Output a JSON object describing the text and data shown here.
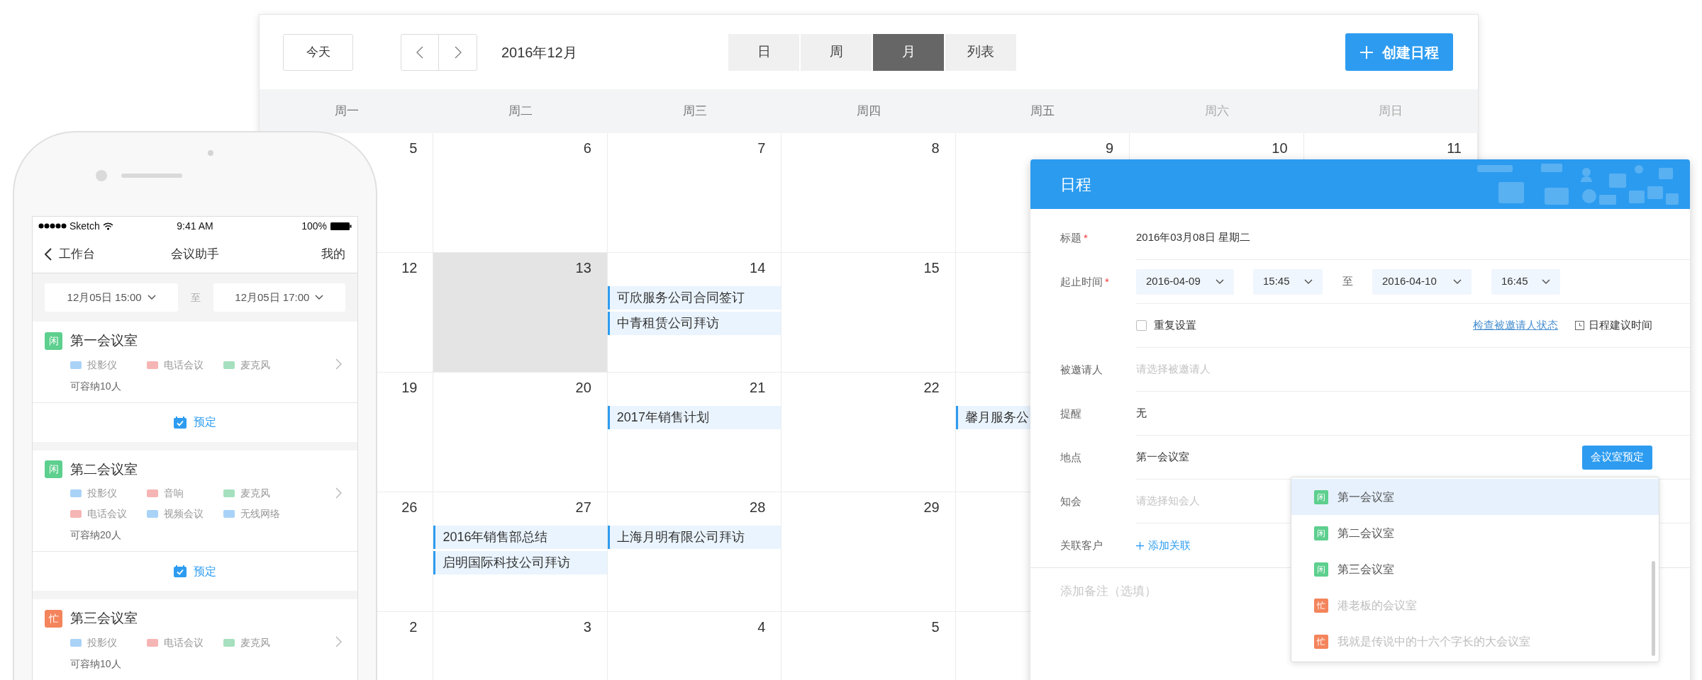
{
  "calendar": {
    "today_button": "今天",
    "month_title": "2016年12月",
    "views": [
      {
        "label": "日",
        "selected": false
      },
      {
        "label": "周",
        "selected": false
      },
      {
        "label": "月",
        "selected": true
      },
      {
        "label": "列表",
        "selected": false
      }
    ],
    "create_button": "创建日程",
    "weekdays": [
      {
        "label": "周一",
        "weekend": false
      },
      {
        "label": "周二",
        "weekend": false
      },
      {
        "label": "周三",
        "weekend": false
      },
      {
        "label": "周四",
        "weekend": false
      },
      {
        "label": "周五",
        "weekend": false
      },
      {
        "label": "周六",
        "weekend": true
      },
      {
        "label": "周日",
        "weekend": true
      }
    ],
    "weeks": [
      [
        {
          "day": "5",
          "shaded": false
        },
        {
          "day": "6",
          "shaded": false
        },
        {
          "day": "7",
          "shaded": false
        },
        {
          "day": "8",
          "shaded": false
        },
        {
          "day": "9",
          "shaded": false
        },
        {
          "day": "10",
          "shaded": false
        },
        {
          "day": "11",
          "shaded": false
        }
      ],
      [
        {
          "day": "12",
          "shaded": false
        },
        {
          "day": "13",
          "shaded": true
        },
        {
          "day": "14",
          "shaded": false,
          "events": [
            "可欣服务公司合同签订",
            "中青租赁公司拜访"
          ]
        },
        {
          "day": "15",
          "shaded": false
        },
        {
          "shaded": false
        }
      ],
      [
        {
          "day": "19",
          "shaded": false
        },
        {
          "day": "20",
          "shaded": false
        },
        {
          "day": "21",
          "shaded": false,
          "events": [
            "2017年销售计划"
          ]
        },
        {
          "day": "22",
          "shaded": false
        },
        {
          "shaded": false,
          "events": [
            "馨月服务公"
          ]
        }
      ],
      [
        {
          "day": "26",
          "shaded": false
        },
        {
          "day": "27",
          "shaded": false,
          "events": [
            "2016年销售部总结",
            "启明国际科技公司拜访"
          ]
        },
        {
          "day": "28",
          "shaded": false,
          "events": [
            "上海月明有限公司拜访"
          ]
        },
        {
          "day": "29",
          "shaded": false
        },
        {
          "shaded": false
        }
      ],
      [
        {
          "day": "2",
          "shaded": false
        },
        {
          "day": "3",
          "shaded": false
        },
        {
          "day": "4",
          "shaded": false
        },
        {
          "day": "5",
          "shaded": false
        },
        {
          "shaded": false
        }
      ]
    ]
  },
  "phone": {
    "status_bar": {
      "carrier": "Sketch",
      "time": "9:41 AM",
      "battery": "100%"
    },
    "nav": {
      "back": "工作台",
      "title": "会议助手",
      "right": "我的"
    },
    "filter": {
      "start": "12月05日 15:00",
      "separator": "至",
      "end": "12月05日 17:00"
    },
    "rooms": [
      {
        "kind": "free",
        "status": "闲",
        "name": "第一会议室",
        "facilities": [
          {
            "label": "投影仪",
            "color": "#a9d2f7"
          },
          {
            "label": "电话会议",
            "color": "#f5b5b5"
          },
          {
            "label": "麦克风",
            "color": "#a6e0bf"
          }
        ],
        "capacity": "可容纳10人",
        "book": "预定"
      },
      {
        "kind": "free",
        "status": "闲",
        "name": "第二会议室",
        "facilities": [
          {
            "label": "投影仪",
            "color": "#a9d2f7"
          },
          {
            "label": "音响",
            "color": "#f5b5b5"
          },
          {
            "label": "麦克风",
            "color": "#a6e0bf"
          },
          {
            "label": "电话会议",
            "color": "#f5b5b5"
          },
          {
            "label": "视频会议",
            "color": "#a9d2f7"
          },
          {
            "label": "无线网络",
            "color": "#a9d2f7"
          }
        ],
        "capacity": "可容纳20人",
        "book": "预定"
      },
      {
        "kind": "busy",
        "status": "忙",
        "name": "第三会议室",
        "facilities": [
          {
            "label": "投影仪",
            "color": "#a9d2f7"
          },
          {
            "label": "电话会议",
            "color": "#f5b5b5"
          },
          {
            "label": "麦克风",
            "color": "#a6e0bf"
          }
        ],
        "capacity": "可容纳10人"
      }
    ]
  },
  "dialog": {
    "title": "日程",
    "fields": [
      {
        "kind": "text",
        "label": "标题",
        "required_mark": "*",
        "value": "2016年03月08日 星期二"
      },
      {
        "kind": "time",
        "label": "起止时间",
        "required_mark": "*",
        "start_date": "2016-04-09",
        "start_time": "15:45",
        "separator": "至",
        "end_date": "2016-04-10",
        "end_time": "16:45"
      },
      {
        "kind": "options",
        "checkbox": {
          "label": "重复设置",
          "checked": false
        },
        "link": "检查被邀请人状态",
        "suggest": "日程建议时间"
      },
      {
        "kind": "input",
        "label": "被邀请人",
        "placeholder": "请选择被邀请人"
      },
      {
        "kind": "text",
        "label": "提醒",
        "value": "无"
      },
      {
        "kind": "location",
        "label": "地点",
        "value": "第一会议室",
        "button": "会议室预定"
      },
      {
        "kind": "input",
        "label": "知会",
        "placeholder": "请选择知会人"
      },
      {
        "kind": "add",
        "label": "关联客户",
        "action": "添加关联"
      }
    ],
    "notes_placeholder": "添加备注（选填）",
    "dropdown": [
      {
        "kind": "free",
        "status": "闲",
        "name": "第一会议室",
        "selected": true
      },
      {
        "kind": "free",
        "status": "闲",
        "name": "第二会议室",
        "selected": false
      },
      {
        "kind": "free",
        "status": "闲",
        "name": "第三会议室",
        "selected": false
      },
      {
        "kind": "busy",
        "status": "忙",
        "name": "港老板的会议室",
        "selected": false
      },
      {
        "kind": "busy",
        "status": "忙",
        "name": "我就是传说中的十六个字长的大会议室",
        "selected": false
      }
    ]
  }
}
